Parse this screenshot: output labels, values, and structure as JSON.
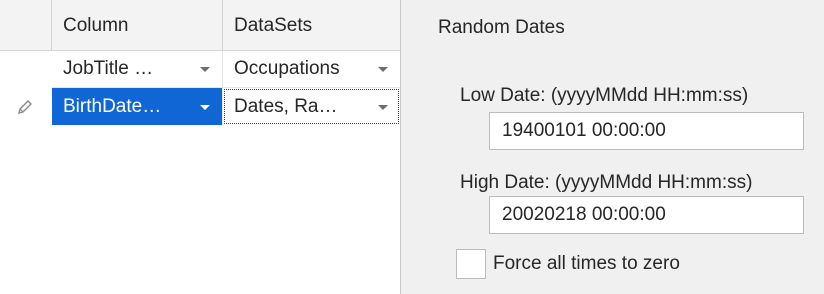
{
  "grid": {
    "headers": {
      "column": "Column",
      "datasets": "DataSets"
    },
    "rows": [
      {
        "column": "JobTitle  …",
        "dataset": "Occupations"
      },
      {
        "column": "BirthDate…",
        "dataset": "Dates, Ra…"
      }
    ]
  },
  "panel": {
    "title": "Random Dates",
    "low_date": {
      "label": "Low Date: (yyyyMMdd HH:mm:ss)",
      "value": "19400101 00:00:00"
    },
    "high_date": {
      "label": "High Date: (yyyyMMdd HH:mm:ss)",
      "value": "20020218 00:00:00"
    },
    "force_zero": {
      "label": "Force all times to zero",
      "checked": false
    }
  },
  "colors": {
    "selection": "#1166d6",
    "panel_bg": "#f0f0f0",
    "header_bg": "#f3f3f3"
  },
  "icons": {
    "row_indicator": "pencil-icon",
    "dropdown": "chevron-down-icon"
  }
}
